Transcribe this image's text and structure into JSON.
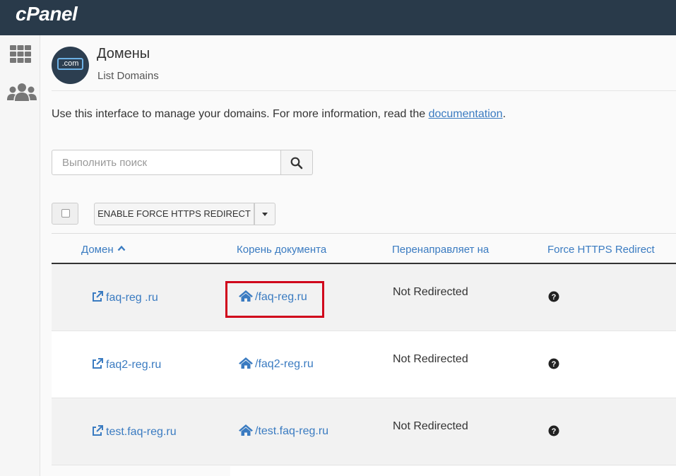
{
  "app": {
    "logo_text": "cPanel"
  },
  "colors": {
    "topbar": "#293a4a",
    "link": "#3a7bc1",
    "highlight": "#d0021b"
  },
  "sidebar": {
    "items": [
      {
        "icon": "grid-icon"
      },
      {
        "icon": "users-icon"
      }
    ]
  },
  "header": {
    "badge_text": ".com",
    "title": "Домены",
    "subtitle": "List Domains"
  },
  "intro": {
    "text": "Use this interface to manage your domains. For more information, read the ",
    "link": "documentation",
    "suffix": "."
  },
  "search": {
    "placeholder": "Выполнить поиск",
    "value": ""
  },
  "bulk": {
    "action_label": "ENABLE FORCE HTTPS REDIRECT"
  },
  "table": {
    "columns": {
      "domain": "Домен",
      "docroot": "Корень документа",
      "redirect": "Перенаправляет на",
      "force": "Force HTTPS Redirect"
    },
    "rows": [
      {
        "domain": "faq-reg .ru",
        "docroot": "/faq-reg.ru",
        "redirect": "Not Redirected"
      },
      {
        "domain": "faq2-reg.ru",
        "docroot": "/faq2-reg.ru",
        "redirect": "Not Redirected"
      },
      {
        "domain": "test.faq-reg.ru",
        "docroot": "/test.faq-reg.ru",
        "redirect": "Not Redirected"
      }
    ]
  }
}
